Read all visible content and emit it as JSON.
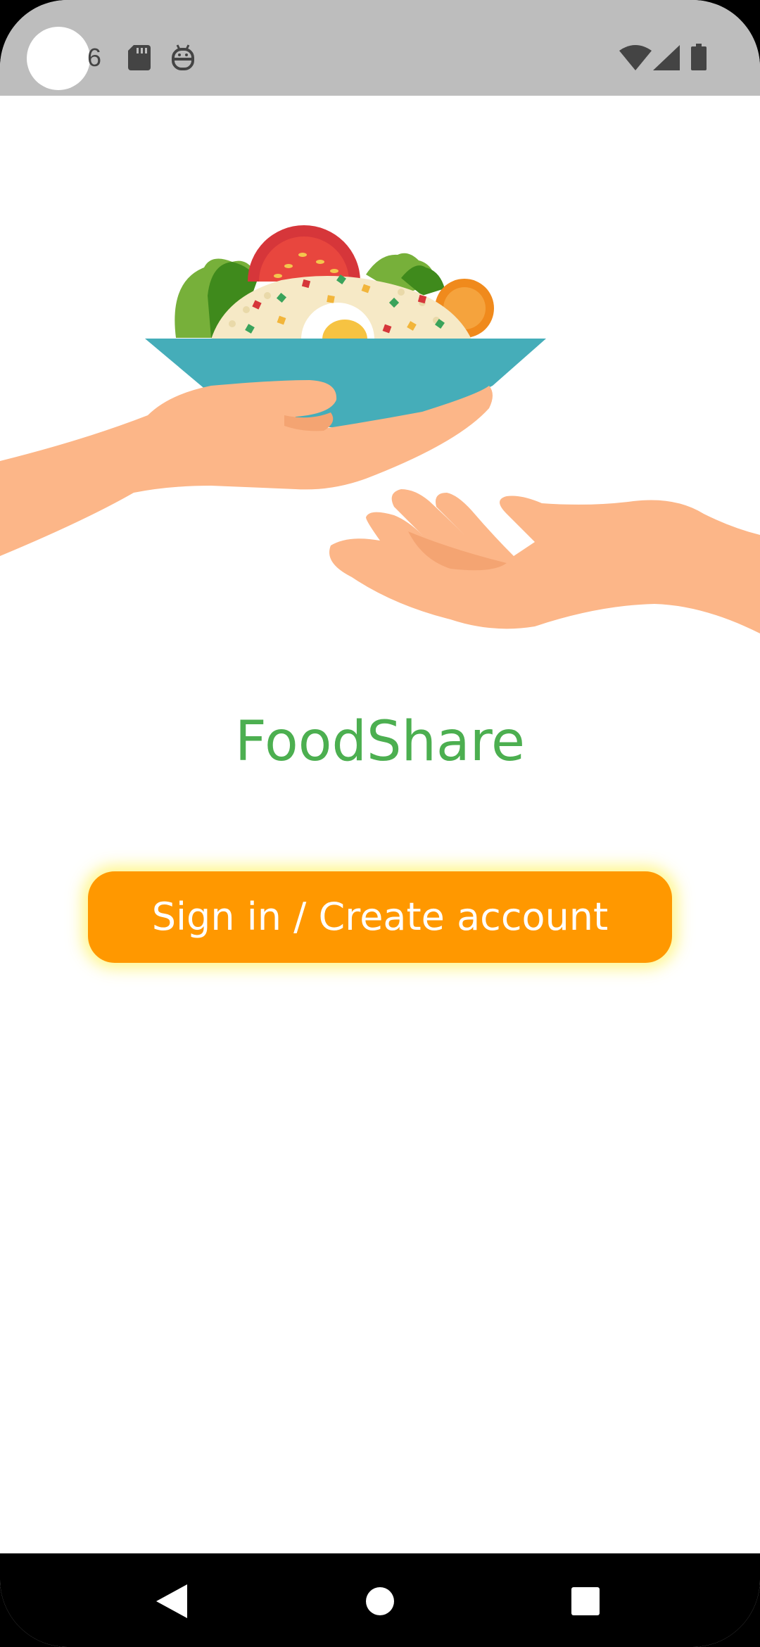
{
  "status_bar": {
    "time": "6",
    "icons": [
      "sd-card-icon",
      "robot-icon",
      "wifi-icon",
      "signal-icon",
      "battery-icon"
    ]
  },
  "illustration": {
    "description_icon": "food-sharing-hands-illustration"
  },
  "app": {
    "title": "FoodShare",
    "title_color": "#4caf50"
  },
  "signin_button": {
    "label": "Sign in / Create account",
    "color": "#ff9800"
  },
  "nav_bar": {
    "icons": [
      "back-icon",
      "home-icon",
      "recents-icon"
    ]
  }
}
